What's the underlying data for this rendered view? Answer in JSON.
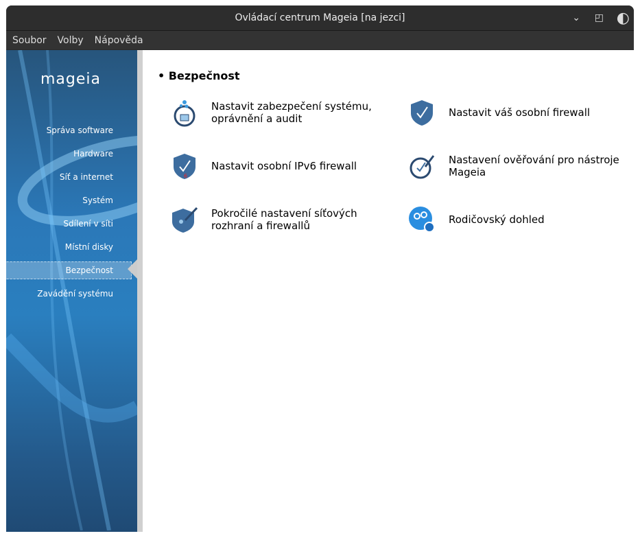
{
  "window": {
    "title": "Ovládací centrum Mageia  [na jezci]"
  },
  "menu": [
    "Soubor",
    "Volby",
    "Nápověda"
  ],
  "sidebar": {
    "logo": "mageia",
    "items": [
      "Správa software",
      "Hardware",
      "Síť a internet",
      "Systém",
      "Sdílení v síti",
      "Místní disky",
      "Bezpečnost",
      "Zavádění systému"
    ],
    "selected": "Bezpečnost"
  },
  "main": {
    "heading": "• Bezpečnost",
    "items": [
      {
        "label": "Nastavit zabezpečení systému, oprávnění a audit",
        "icon": "security-lock-icon"
      },
      {
        "label": "Nastavit váš osobní firewall",
        "icon": "shield-check-icon"
      },
      {
        "label": "Nastavit osobní IPv6 firewall",
        "icon": "shield-ipv6-icon"
      },
      {
        "label": "Nastavení ověřování pro nástroje Mageia",
        "icon": "auth-icon"
      },
      {
        "label": "Pokročilé nastavení síťových rozhraní a firewallů",
        "icon": "shield-advanced-icon"
      },
      {
        "label": "Rodičovský dohled",
        "icon": "parental-control-icon"
      }
    ]
  }
}
